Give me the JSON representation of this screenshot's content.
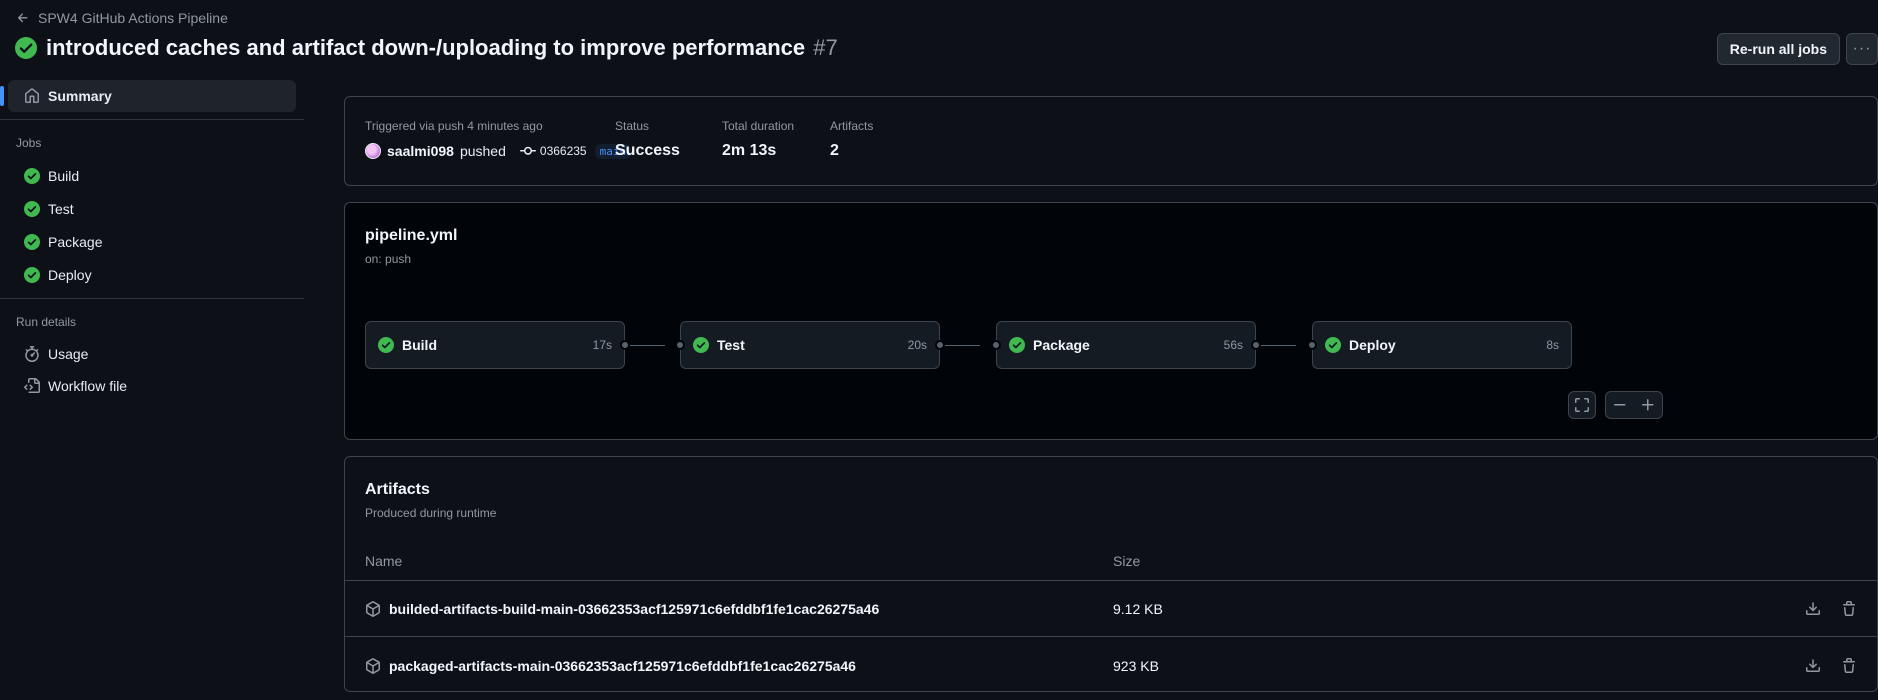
{
  "header": {
    "back_label": "SPW4 GitHub Actions Pipeline",
    "title": "introduced caches and artifact down-/uploading to improve performance",
    "run_number": "#7",
    "rerun_label": "Re-run all jobs",
    "more_label": "···"
  },
  "sidebar": {
    "summary_label": "Summary",
    "jobs_heading": "Jobs",
    "jobs": [
      {
        "label": "Build"
      },
      {
        "label": "Test"
      },
      {
        "label": "Package"
      },
      {
        "label": "Deploy"
      }
    ],
    "run_details_heading": "Run details",
    "usage_label": "Usage",
    "workflow_file_label": "Workflow file"
  },
  "summary": {
    "trigger_label": "Triggered via push 4 minutes ago",
    "actor": "saalmi098",
    "action": "pushed",
    "commit": "0366235",
    "branch": "main",
    "status_label": "Status",
    "status_value": "Success",
    "duration_label": "Total duration",
    "duration_value": "2m 13s",
    "artifacts_label": "Artifacts",
    "artifacts_value": "2"
  },
  "pipeline": {
    "file": "pipeline.yml",
    "trigger": "on: push",
    "jobs": [
      {
        "name": "Build",
        "time": "17s"
      },
      {
        "name": "Test",
        "time": "20s"
      },
      {
        "name": "Package",
        "time": "56s"
      },
      {
        "name": "Deploy",
        "time": "8s"
      }
    ]
  },
  "artifacts": {
    "title": "Artifacts",
    "subtitle": "Produced during runtime",
    "col_name": "Name",
    "col_size": "Size",
    "items": [
      {
        "name": "builded-artifacts-build-main-03662353acf125971c6efddbf1fe1cac26275a46",
        "size": "9.12 KB"
      },
      {
        "name": "packaged-artifacts-main-03662353acf125971c6efddbf1fe1cac26275a46",
        "size": "923 KB"
      }
    ]
  },
  "colors": {
    "success": "#3fb950",
    "accent": "#4493f8",
    "background": "#0d1117"
  },
  "icons": {
    "back": "arrow-left-icon",
    "status": "check-circle-fill-icon",
    "summary": "home-icon",
    "usage": "stopwatch-icon",
    "workflow": "file-code-icon",
    "commit": "git-commit-icon",
    "artifact": "package-icon",
    "download": "download-icon",
    "delete": "trash-icon",
    "fullscreen": "screen-full-icon"
  }
}
